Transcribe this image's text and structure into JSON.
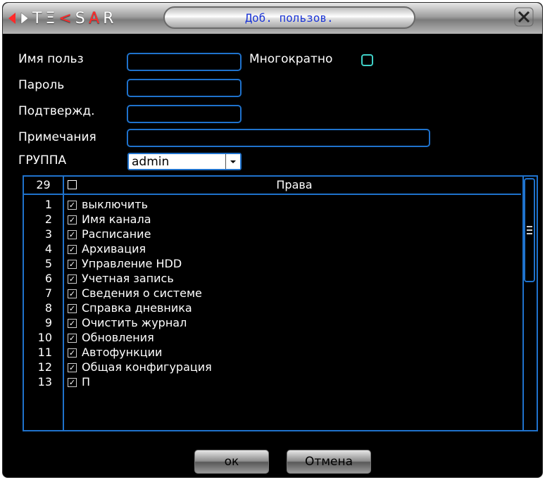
{
  "titlebar": {
    "logo": "TEKSAR",
    "title": "Доб. пользов."
  },
  "form": {
    "username_label": "Имя польз",
    "username_value": "",
    "reusable_label": "Многократно",
    "reusable_checked": false,
    "password_label": "Пароль",
    "password_value": "",
    "confirm_label": "Подтвержд.",
    "confirm_value": "",
    "notes_label": "Примечания",
    "notes_value": "",
    "group_label": "ГРУППА",
    "group_value": "admin"
  },
  "rights": {
    "count": "29",
    "header": "Права",
    "items": [
      {
        "num": "1",
        "label": "выключить",
        "checked": true
      },
      {
        "num": "2",
        "label": "Имя канала",
        "checked": true
      },
      {
        "num": "3",
        "label": "Расписание",
        "checked": true
      },
      {
        "num": "4",
        "label": "Архивация",
        "checked": true
      },
      {
        "num": "5",
        "label": "Управление HDD",
        "checked": true
      },
      {
        "num": "6",
        "label": "Учетная запись",
        "checked": true
      },
      {
        "num": "7",
        "label": "Сведения о системе",
        "checked": true
      },
      {
        "num": "8",
        "label": "Справка дневника",
        "checked": true
      },
      {
        "num": "9",
        "label": "Очистить журнал",
        "checked": true
      },
      {
        "num": "10",
        "label": "Обновления",
        "checked": true
      },
      {
        "num": "11",
        "label": "Автофункции",
        "checked": true
      },
      {
        "num": "12",
        "label": "Общая конфигурация",
        "checked": true
      },
      {
        "num": "13",
        "label": "П",
        "checked": true
      }
    ]
  },
  "buttons": {
    "ok": "ок",
    "cancel": "Отмена"
  },
  "colors": {
    "border": "#1f72cc",
    "title_text": "#1c36d6",
    "reusable_checkbox": "#3fd0c7",
    "logo_accent": "#ff2a2a"
  },
  "icons": {
    "logo_arrows": "logo-arrows-icon",
    "close": "close-icon",
    "dropdown": "chevron-down-icon",
    "checkbox": "checkbox-icon"
  }
}
